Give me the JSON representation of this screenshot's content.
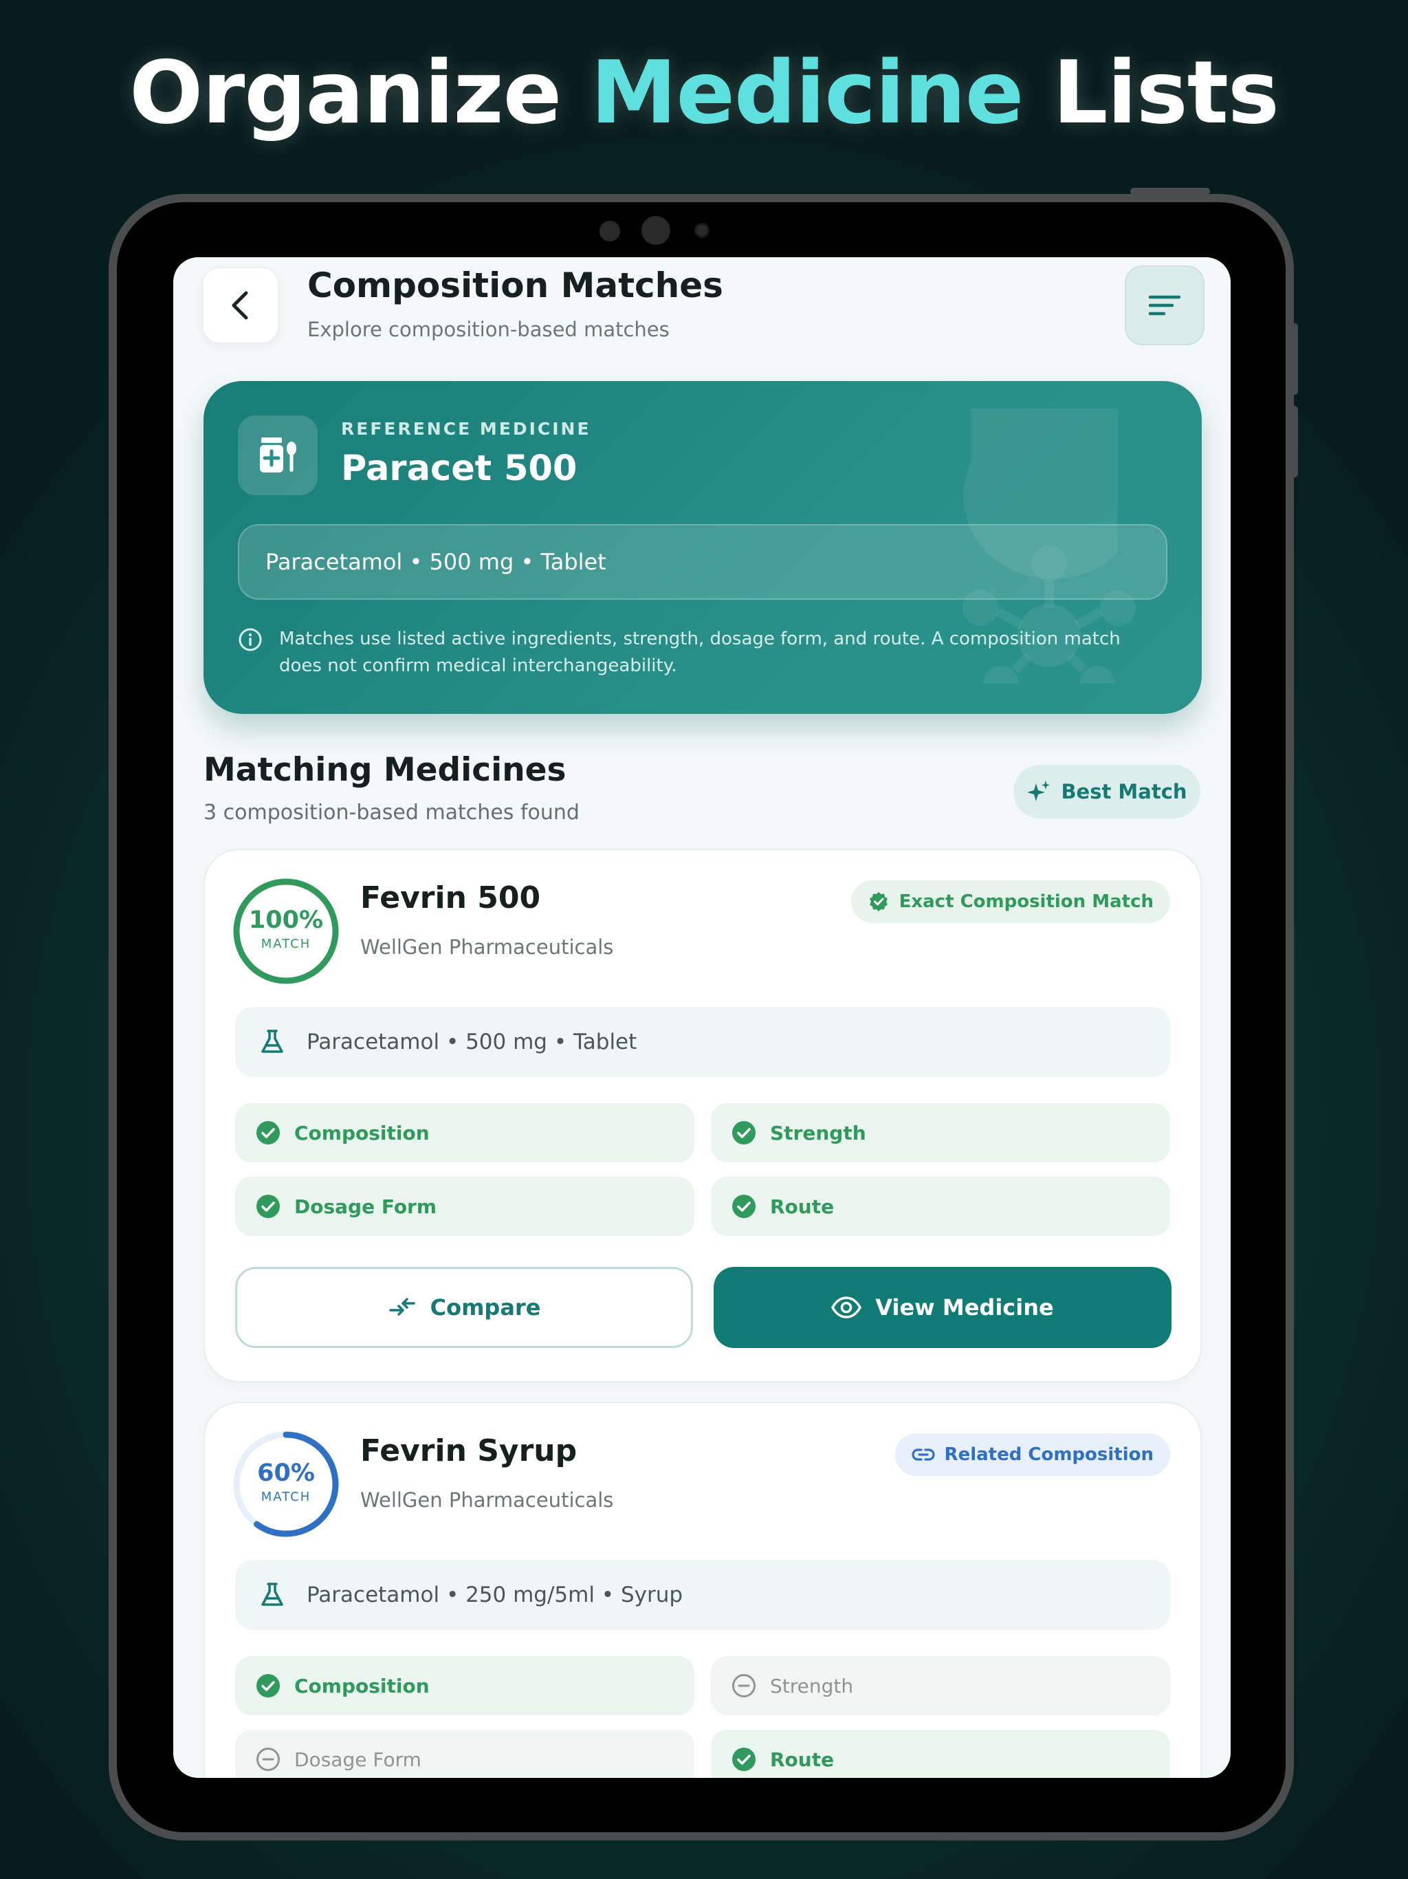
{
  "headline": {
    "part1": "Organize ",
    "accent": "Medicine",
    "part2": " Lists"
  },
  "colors": {
    "accent": "#5fe0df",
    "primary": "#117c75",
    "success": "#2f9a5b",
    "related": "#2f6fc4"
  },
  "topbar": {
    "title": "Composition Matches",
    "subtitle": "Explore composition-based matches",
    "back_icon": "chevron-left-icon",
    "filter_icon": "filter-lines-icon"
  },
  "reference": {
    "label": "REFERENCE MEDICINE",
    "name": "Paracet 500",
    "composition": "Paracetamol • 500 mg • Tablet",
    "note": "Matches use listed active ingredients, strength, dosage form, and route. A composition match does not confirm medical interchangeability."
  },
  "section": {
    "title": "Matching Medicines",
    "subtitle": "3 composition-based matches found",
    "best_match_label": "Best Match"
  },
  "matches": [
    {
      "percent": "100%",
      "percent_value": 100,
      "match_label": "MATCH",
      "name": "Fevrin 500",
      "maker": "WellGen Pharmaceuticals",
      "badge": "Exact Composition Match",
      "composition": "Paracetamol • 500 mg • Tablet",
      "criteria": [
        {
          "label": "Composition",
          "matched": true
        },
        {
          "label": "Strength",
          "matched": true
        },
        {
          "label": "Dosage Form",
          "matched": true
        },
        {
          "label": "Route",
          "matched": true
        }
      ],
      "compare_label": "Compare",
      "view_label": "View Medicine"
    },
    {
      "percent": "60%",
      "percent_value": 60,
      "match_label": "MATCH",
      "name": "Fevrin Syrup",
      "maker": "WellGen Pharmaceuticals",
      "badge": "Related Composition",
      "composition": "Paracetamol • 250 mg/5ml • Syrup",
      "criteria": [
        {
          "label": "Composition",
          "matched": true
        },
        {
          "label": "Strength",
          "matched": false
        },
        {
          "label": "Dosage Form",
          "matched": false
        },
        {
          "label": "Route",
          "matched": true
        }
      ]
    }
  ]
}
